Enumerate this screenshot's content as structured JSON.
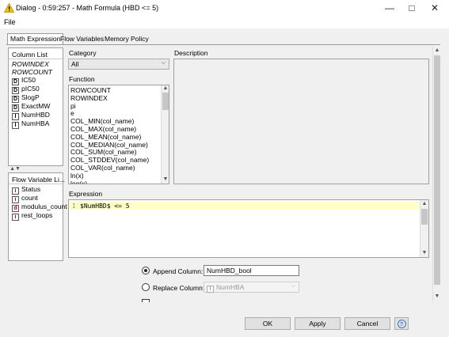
{
  "window": {
    "title": "Dialog - 0:59:257 - Math Formula (HBD <= 5)"
  },
  "menu": {
    "file": "File"
  },
  "tabs": [
    "Math Expression",
    "Flow Variables",
    "Memory Policy"
  ],
  "column_list": {
    "header": "Column List",
    "items": [
      {
        "label": "ROWINDEX",
        "type": "",
        "italic": true
      },
      {
        "label": "ROWCOUNT",
        "type": "",
        "italic": true
      },
      {
        "label": "IC50",
        "type": "D",
        "italic": false
      },
      {
        "label": "pIC50",
        "type": "D",
        "italic": false
      },
      {
        "label": "SlogP",
        "type": "D",
        "italic": false
      },
      {
        "label": "ExactMW",
        "type": "D",
        "italic": false
      },
      {
        "label": "NumHBD",
        "type": "I",
        "italic": false
      },
      {
        "label": "NumHBA",
        "type": "I",
        "italic": false
      }
    ]
  },
  "flow_variables": {
    "header": "Flow Variable Li...",
    "items": [
      {
        "label": "Status",
        "type": "i"
      },
      {
        "label": "count",
        "type": "i"
      },
      {
        "label": "modulus_count",
        "type": "d"
      },
      {
        "label": "rest_loops",
        "type": "i"
      }
    ]
  },
  "category": {
    "label": "Category",
    "value": "All"
  },
  "function": {
    "label": "Function",
    "items": [
      "ROWCOUNT",
      "ROWINDEX",
      "pi",
      "e",
      "COL_MIN(col_name)",
      "COL_MAX(col_name)",
      "COL_MEAN(col_name)",
      "COL_MEDIAN(col_name)",
      "COL_SUM(col_name)",
      "COL_STDDEV(col_name)",
      "COL_VAR(col_name)",
      "ln(x)",
      "log(x)"
    ]
  },
  "description": {
    "label": "Description"
  },
  "expression": {
    "label": "Expression",
    "line_number": "1",
    "text": "$NumHBD$ <= 5"
  },
  "options": {
    "append_label": "Append Column:",
    "append_value": "NumHBD_bool",
    "replace_label": "Replace Column:",
    "replace_value": "NumHBA",
    "replace_type": "I"
  },
  "buttons": {
    "ok": "OK",
    "apply": "Apply",
    "cancel": "Cancel",
    "help": "?"
  },
  "colors": {
    "expr_highlight": "#ffffc8",
    "help_blue": "#3a78c8",
    "warn_yellow": "#f5c400"
  }
}
